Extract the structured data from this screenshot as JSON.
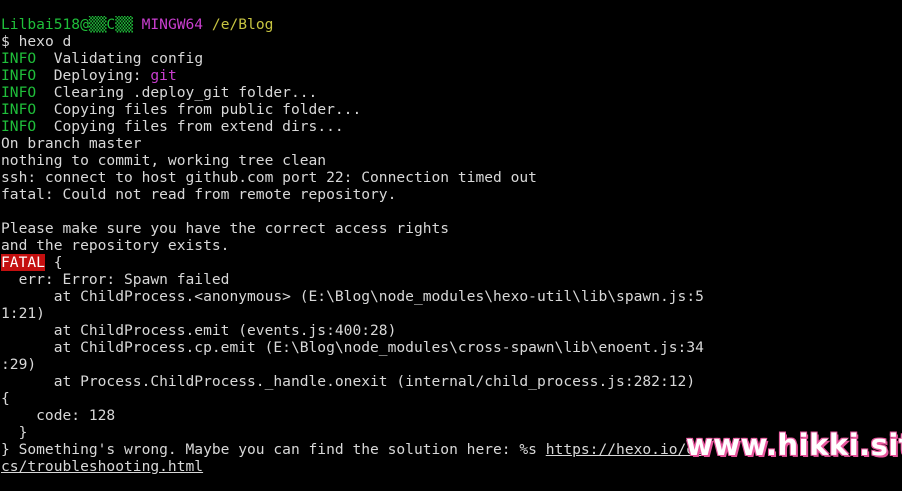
{
  "prompt": {
    "user_host": "Lilbai518@▒▒C▒▒",
    "shell": "MINGW64",
    "path": "/e/Blog",
    "symbol": "$",
    "command": "hexo d"
  },
  "info_lines": [
    {
      "level": "INFO",
      "text": "Validating config",
      "highlight": ""
    },
    {
      "level": "INFO",
      "text": "Deploying: ",
      "highlight": "git"
    },
    {
      "level": "INFO",
      "text": "Clearing .deploy_git folder...",
      "highlight": ""
    },
    {
      "level": "INFO",
      "text": "Copying files from public folder...",
      "highlight": ""
    },
    {
      "level": "INFO",
      "text": "Copying files from extend dirs...",
      "highlight": ""
    }
  ],
  "git_output": [
    "On branch master",
    "nothing to commit, working tree clean",
    "ssh: connect to host github.com port 22: Connection timed out",
    "fatal: Could not read from remote repository.",
    "",
    "Please make sure you have the correct access rights",
    "and the repository exists."
  ],
  "fatal": {
    "badge": "FATAL",
    "open": " {",
    "err_line": "  err: Error: Spawn failed",
    "stack": [
      "      at ChildProcess.<anonymous> (E:\\Blog\\node_modules\\hexo-util\\lib\\spawn.js:5",
      "1:21)",
      "      at ChildProcess.emit (events.js:400:28)",
      "      at ChildProcess.cp.emit (E:\\Blog\\node_modules\\cross-spawn\\lib\\enoent.js:34",
      ":29)",
      "      at Process.ChildProcess._handle.onexit (internal/child_process.js:282:12)",
      "{",
      "    code: 128",
      "  }"
    ],
    "closing_prefix": "} Something's wrong. Maybe you can find the solution here: %s ",
    "link_part1": "https://hexo.io/do",
    "link_part2": "cs/troubleshooting.html"
  },
  "watermark": "www.hikki.site",
  "colors": {
    "background": "#000000",
    "text": "#d8d8d8",
    "info_green": "#1fbf3a",
    "shell_magenta": "#c93ecf",
    "path_yellow": "#c7c441",
    "fatal_red": "#c40f0f",
    "watermark_pink": "#e6559c"
  }
}
